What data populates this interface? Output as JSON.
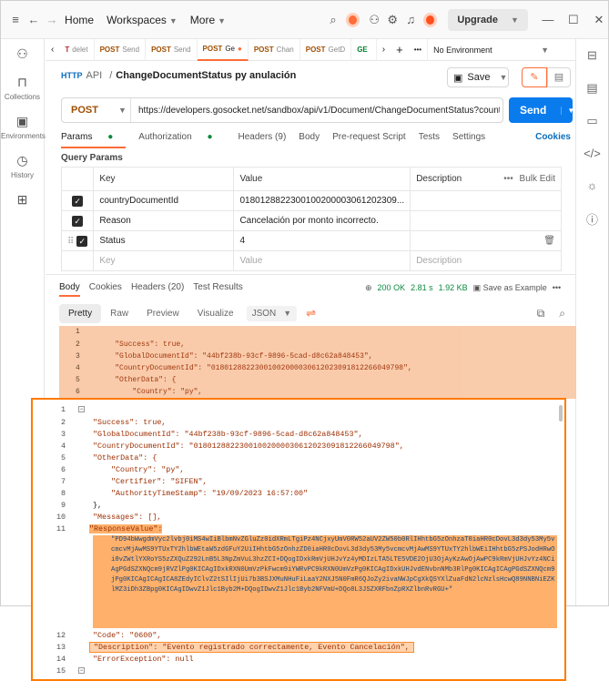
{
  "titlebar": {
    "home": "Home",
    "workspaces": "Workspaces",
    "more": "More",
    "upgrade": "Upgrade"
  },
  "sidebar": [
    {
      "icon": "collections-icon",
      "label": "Collections"
    },
    {
      "icon": "environments-icon",
      "label": "Environments"
    },
    {
      "icon": "history-icon",
      "label": "History"
    },
    {
      "icon": "apps-icon",
      "label": ""
    }
  ],
  "tabs": [
    {
      "method": "T",
      "name": "delet"
    },
    {
      "method": "POST",
      "name": "Send"
    },
    {
      "method": "POST",
      "name": "Send"
    },
    {
      "method": "POST",
      "name": "Ge"
    },
    {
      "method": "POST",
      "name": "Chan"
    },
    {
      "method": "POST",
      "name": "GetD"
    },
    {
      "method": "GE",
      "name": ""
    }
  ],
  "env": "No Environment",
  "breadcrumb": {
    "root": "API",
    "sep": "/",
    "name": "ChangeDocumentStatus py anulación"
  },
  "save": "Save",
  "request": {
    "method": "POST",
    "url": "https://developers.gosocket.net/sandbox/api/v1/Document/ChangeDocumentStatus?countryDoc...",
    "send": "Send"
  },
  "reqtabs": [
    "Params",
    "Authorization",
    "Headers (9)",
    "Body",
    "Pre-request Script",
    "Tests",
    "Settings"
  ],
  "cookies": "Cookies",
  "query_params": "Query Params",
  "ptable": {
    "headers": [
      "Key",
      "Value",
      "Description",
      "Bulk Edit"
    ],
    "rows": [
      {
        "key": "countryDocumentId",
        "value": "0180128822300100200003061202309..."
      },
      {
        "key": "Reason",
        "value": "Cancelación por monto incorrecto."
      },
      {
        "key": "Status",
        "value": "4"
      }
    ],
    "placeholder": {
      "key": "Key",
      "value": "Value",
      "desc": "Description"
    }
  },
  "resptabs": [
    "Body",
    "Cookies",
    "Headers (20)",
    "Test Results"
  ],
  "respmeta": {
    "status": "200 OK",
    "time": "2.81 s",
    "size": "1.92 KB",
    "save": "Save as Example"
  },
  "views": [
    "Pretty",
    "Raw",
    "Preview",
    "Visualize"
  ],
  "format": "JSON",
  "code": {
    "line_numbers": [
      "1",
      "2",
      "3",
      "4",
      "5",
      "6",
      "7",
      "8",
      "9",
      "10",
      "11",
      "12",
      "13",
      "14",
      "15"
    ],
    "l2": "\"Success\": true,",
    "l3": "\"GlobalDocumentId\": \"44bf238b-93cf-9896-5cad-d8c62a848453\",",
    "l4": "\"CountryDocumentId\": \"01801288223001002000030612023091812266049798\",",
    "l5": "\"OtherData\": {",
    "l6": "\"Country\": \"py\",",
    "l7": "\"Certifier\": \"SIFEN\",",
    "l8": "\"AuthorityTimeStamp\": \"19/09/2023 16:57:00\"",
    "l9": "},",
    "l10": "\"Messages\": [],",
    "l11": "\"ResponseValue\":",
    "blob": "\"PD94bWwgdmVyc2lvbj0iMS4wIiBlbmNvZGluZz0idXRmLTgiPz4NCjxyUmV0RW52aUV2ZW50b0RlIHhtbG5zOnhzaT0iaHR0cDovL3d3dy53My5vcmcvMjAwMS9YTUxTY2hlbWEtaW5zdGFuY2UiIHhtbG5zOnhzZD0iaHR0cDovL3d3dy53My5vcmcvMjAwMS9YTUxTY2hlbWEiIHhtbG5zPSJodHRwOi8vZWtlYXRoYS5zZXQuZ292LnB5L3NpZmVuL3hzZCI+DQogIDxkRmVjUHJvYz4yMDIzLTA5LTE5VDE2OjU3OjAyKzAwOjAwPC9kRmVjUHJvYz4NCiAgPGdSZXNQcm9jRVZlPg0KICAgIDxkRXN0UmVzPkFwcm9iYWRvPC9kRXN0UmVzPg0KICAgIDxkUHJvdENvbnNMb3RlPg0KICAgICAgPGdSZXNQcm9jPg0KICAgICAgICA8ZEdyIClvZ2tSIlIjUi7b3BSJXMuNHuFiLaaY2NXJ5N0FmR6QJoZy2ivaNWJpCgXkQSYXlZuaFdN2lcNzlsHcwQ89NNBNiEZKlMZ3iDh3ZBpg0KICAgIDwvZ1Jlc1Byb2M+DQogIDwvZ1Jlc1Byb2NFVmU+DQo8L3JSZXRFbnZpRXZlbnRvRGU+\"",
    "l12": "\"Code\": \"0600\",",
    "l13": "\"Description\": \"Evento registrado correctamente, Evento Cancelación\",",
    "l14": "\"ErrorException\": null"
  }
}
